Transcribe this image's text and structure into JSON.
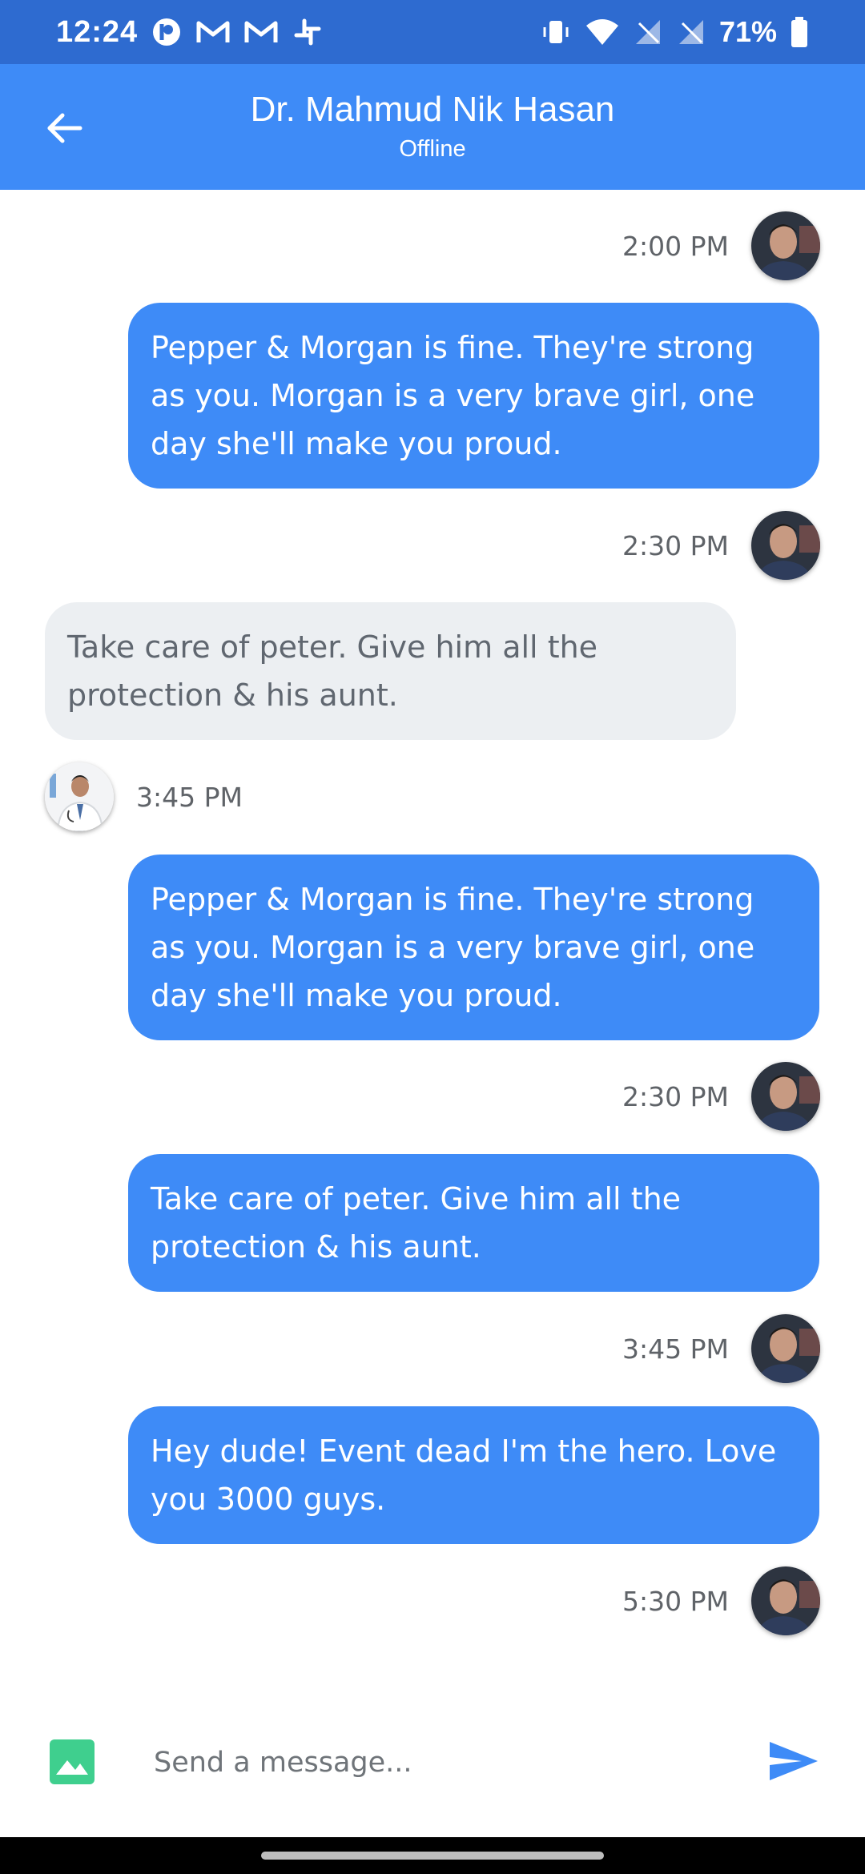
{
  "status_bar": {
    "time": "12:24",
    "battery": "71%",
    "left_icons": [
      "pinwheel-app-icon",
      "gmail-icon",
      "gmail-icon",
      "slack-icon"
    ],
    "right_icons": [
      "vibrate-icon",
      "wifi-icon",
      "no-signal-icon",
      "no-signal-icon",
      "battery-icon"
    ]
  },
  "header": {
    "back_icon": "arrow-left-icon",
    "title": "Dr. Mahmud Nik Hasan",
    "subtitle": "Offline",
    "color": "#3e8bf7"
  },
  "messages": [
    {
      "time": "2:00 PM"
    },
    {
      "text": "Pepper & Morgan is fine. They're strong as you. Morgan is a very brave girl, one day she'll make you proud.",
      "time": "2:30 PM"
    },
    {
      "text": "Take care of peter. Give him all the protection & his aunt.",
      "time": "3:45 PM"
    },
    {
      "text": "Pepper & Morgan is fine. They're strong as you. Morgan is a very brave girl, one day she'll make you proud.",
      "time": "2:30 PM"
    },
    {
      "text": "Take care of peter. Give him all the protection & his aunt.",
      "time": "3:45 PM"
    },
    {
      "text": "Hey dude! Event dead I'm the hero. Love you 3000 guys.",
      "time": "5:30 PM"
    }
  ],
  "composer": {
    "image_icon": "image-icon",
    "placeholder": "Send a message...",
    "value": "",
    "send_icon": "send-icon"
  },
  "colors": {
    "outgoing_bubble": "#3e8bf7",
    "incoming_bubble": "#eceff2",
    "status_bar": "#2e6bd0",
    "image_button": "#3fcf8e"
  }
}
